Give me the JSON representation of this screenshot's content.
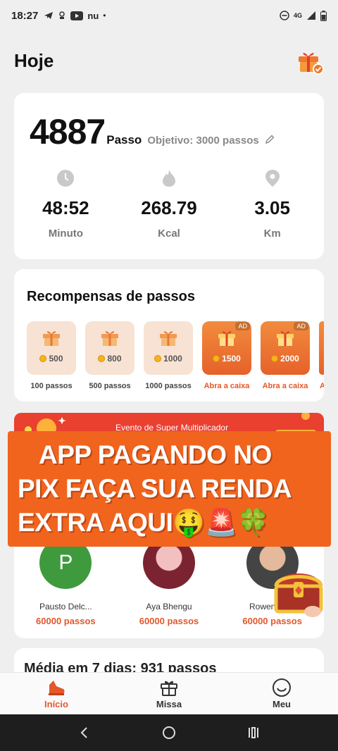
{
  "status": {
    "time": "18:27",
    "network": "4G",
    "notif_text": "nu"
  },
  "header": {
    "title": "Hoje"
  },
  "steps": {
    "count": "4887",
    "unit": "Passo",
    "goal": "Objetivo: 3000 passos"
  },
  "stats": [
    {
      "value": "48:52",
      "label": "Minuto",
      "icon": "clock-icon"
    },
    {
      "value": "268.79",
      "label": "Kcal",
      "icon": "flame-icon"
    },
    {
      "value": "3.05",
      "label": "Km",
      "icon": "location-pin-icon"
    }
  ],
  "rewards": {
    "title": "Recompensas de passos",
    "items": [
      {
        "coins": "500",
        "label": "100 passos",
        "ad": false
      },
      {
        "coins": "800",
        "label": "500 passos",
        "ad": false
      },
      {
        "coins": "1000",
        "label": "1000 passos",
        "ad": false
      },
      {
        "coins": "1500",
        "label": "Abra a caixa",
        "ad": true,
        "badge": "AD"
      },
      {
        "coins": "2000",
        "label": "Abra a caixa",
        "ad": true,
        "badge": "AD"
      },
      {
        "label": "A"
      }
    ]
  },
  "banner": {
    "text": "Evento de Super Multiplicador"
  },
  "overlay": {
    "lines": [
      "APP PAGANDO NO",
      "PIX FAÇA SUA RENDA",
      "EXTRA AQUI🤑🚨🍀"
    ]
  },
  "leaders": [
    {
      "initial": "P",
      "name": "Pausto Delc...",
      "steps": "60000 passos"
    },
    {
      "name": "Aya Bhengu",
      "steps": "60000 passos"
    },
    {
      "name": "Rowena B...",
      "steps": "60000 passos"
    }
  ],
  "average": {
    "title": "Média em 7 dias: 931 passos"
  },
  "tabs": [
    {
      "label": "Início",
      "active": true
    },
    {
      "label": "Missa",
      "active": false
    },
    {
      "label": "Meu",
      "active": false
    }
  ],
  "colors": {
    "accent": "#e4572a",
    "overlay": "#f0641e",
    "banner": "#e9402f"
  }
}
